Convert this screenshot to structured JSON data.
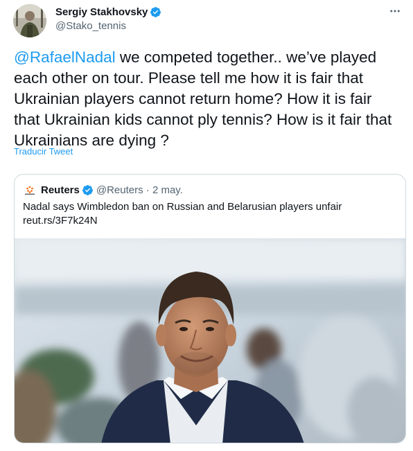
{
  "author": {
    "display_name": "Sergiy Stakhovsky",
    "handle": "@Stako_tennis"
  },
  "tweet": {
    "mention": "@RafaelNadal",
    "text": " we competed together.. we’ve played each other on tour. Please tell me how it is fair that Ukrainian players cannot return home? How it is fair that Ukrainian kids cannot ply tennis? How is it fair that Ukrainians are dying ?",
    "translate_label": "Traducir Tweet"
  },
  "quoted": {
    "name": "Reuters",
    "handle": "@Reuters",
    "separator": " · ",
    "date": "2 may.",
    "text": "Nadal says Wimbledon ban on Russian and Belarusian players unfair",
    "link": "reut.rs/3F7k24N"
  },
  "colors": {
    "accent": "#1d9bf0",
    "secondary_text": "#536471",
    "border": "#cfd9de"
  },
  "icons": [
    "more-options-icon",
    "verified-badge-icon",
    "reuters-logo-icon"
  ]
}
